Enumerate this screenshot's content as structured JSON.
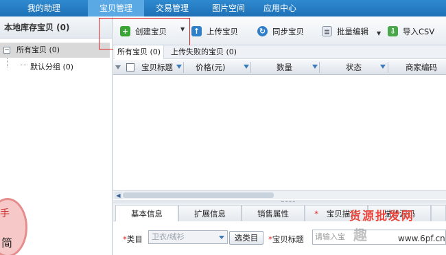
{
  "nav": {
    "tabs": [
      "我的助理",
      "宝贝管理",
      "交易管理",
      "图片空间",
      "应用中心"
    ],
    "active_index": 1
  },
  "left": {
    "header": "本地库存宝贝 (0)",
    "tree_root": "所有宝贝 (0)",
    "tree_toggle": "−",
    "tree_child": "默认分组 (0)"
  },
  "badge": {
    "char1": "手",
    "char2": "简"
  },
  "toolbar": {
    "create": "创建宝贝",
    "upload": "上传宝贝",
    "sync": "同步宝贝",
    "batch": "批量编辑",
    "import": "导入CSV"
  },
  "filter_tabs": [
    "所有宝贝 (0)",
    "上传失败的宝贝 (0)"
  ],
  "grid": {
    "columns": [
      "宝贝标题",
      "价格(元)",
      "数量",
      "状态",
      "商家编码"
    ]
  },
  "lower_tabs": [
    "基本信息",
    "扩展信息",
    "销售属性",
    "宝贝描述",
    "描述源码"
  ],
  "form": {
    "category_label": "类目",
    "category_value": "卫衣/绒衫",
    "select_category_button": "选类目",
    "title_label": "宝贝标题",
    "title_placeholder": "请输入宝"
  },
  "watermark": {
    "line1": "货源批发网",
    "line2": "趣",
    "line3": "www.6pf.cn"
  },
  "colors": {
    "nav_bg": "#1e70b6",
    "nav_active": "#5aa9e4",
    "highlight": "#e02020"
  }
}
